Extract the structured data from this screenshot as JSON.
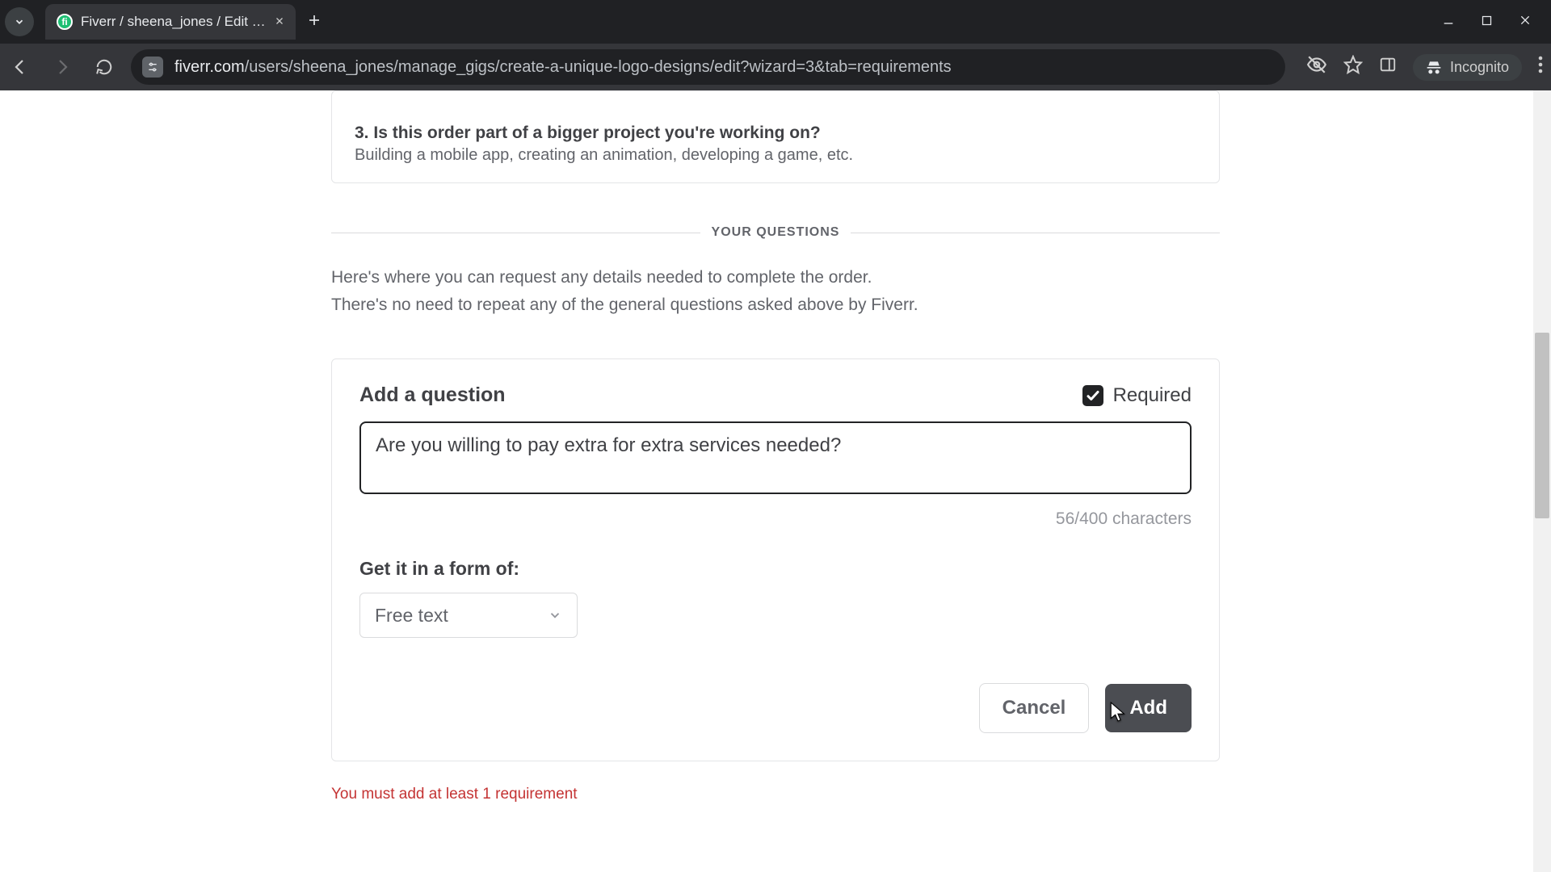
{
  "window": {
    "tab_title": "Fiverr / sheena_jones / Edit Gig",
    "url_domain": "fiverr.com",
    "url_path": "/users/sheena_jones/manage_gigs/create-a-unique-logo-designs/edit?wizard=3&tab=requirements",
    "incognito_label": "Incognito"
  },
  "page": {
    "prev_question": {
      "number_label": "3.",
      "text": "Is this order part of a bigger project you're working on?",
      "desc": "Building a mobile app, creating an animation, developing a game, etc."
    },
    "section_title": "YOUR QUESTIONS",
    "intro_line1": "Here's where you can request any details needed to complete the order.",
    "intro_line2": "There's no need to repeat any of the general questions asked above by Fiverr.",
    "q_card": {
      "title": "Add a question",
      "required_label": "Required",
      "input_value": "Are you willing to pay extra for extra services needed? ",
      "counter": "56/400 characters",
      "form_of_label": "Get it in a form of:",
      "select_value": "Free text",
      "cancel_label": "Cancel",
      "add_label": "Add"
    },
    "warning": "You must add at least 1 requirement"
  },
  "icons": {
    "chevron_down": "chevron-down-icon",
    "close": "close-icon",
    "plus": "plus-icon"
  },
  "colors": {
    "fiverr_green": "#1dbf73",
    "text_dark": "#404145",
    "text_muted": "#62646a",
    "warn": "#c43333"
  }
}
